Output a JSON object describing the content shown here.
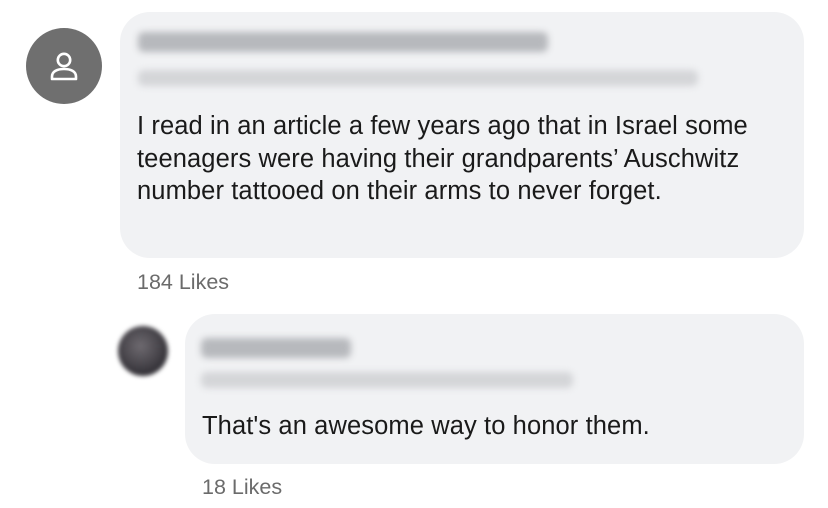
{
  "comments": [
    {
      "text": "I read in an article a few years ago that in Israel some teenagers were having their grandparents’ Auschwitz number tattooed on their arms to never forget.",
      "likes": "184 Likes",
      "avatar_icon": "person-icon"
    },
    {
      "text": "That's an awesome way to honor them.",
      "likes": "18 Likes"
    }
  ],
  "colors": {
    "bubble_bg": "#f1f2f4",
    "avatar_bg": "#6f6f6f",
    "text": "#1a1a1a",
    "meta_text": "#6b6b6b"
  }
}
